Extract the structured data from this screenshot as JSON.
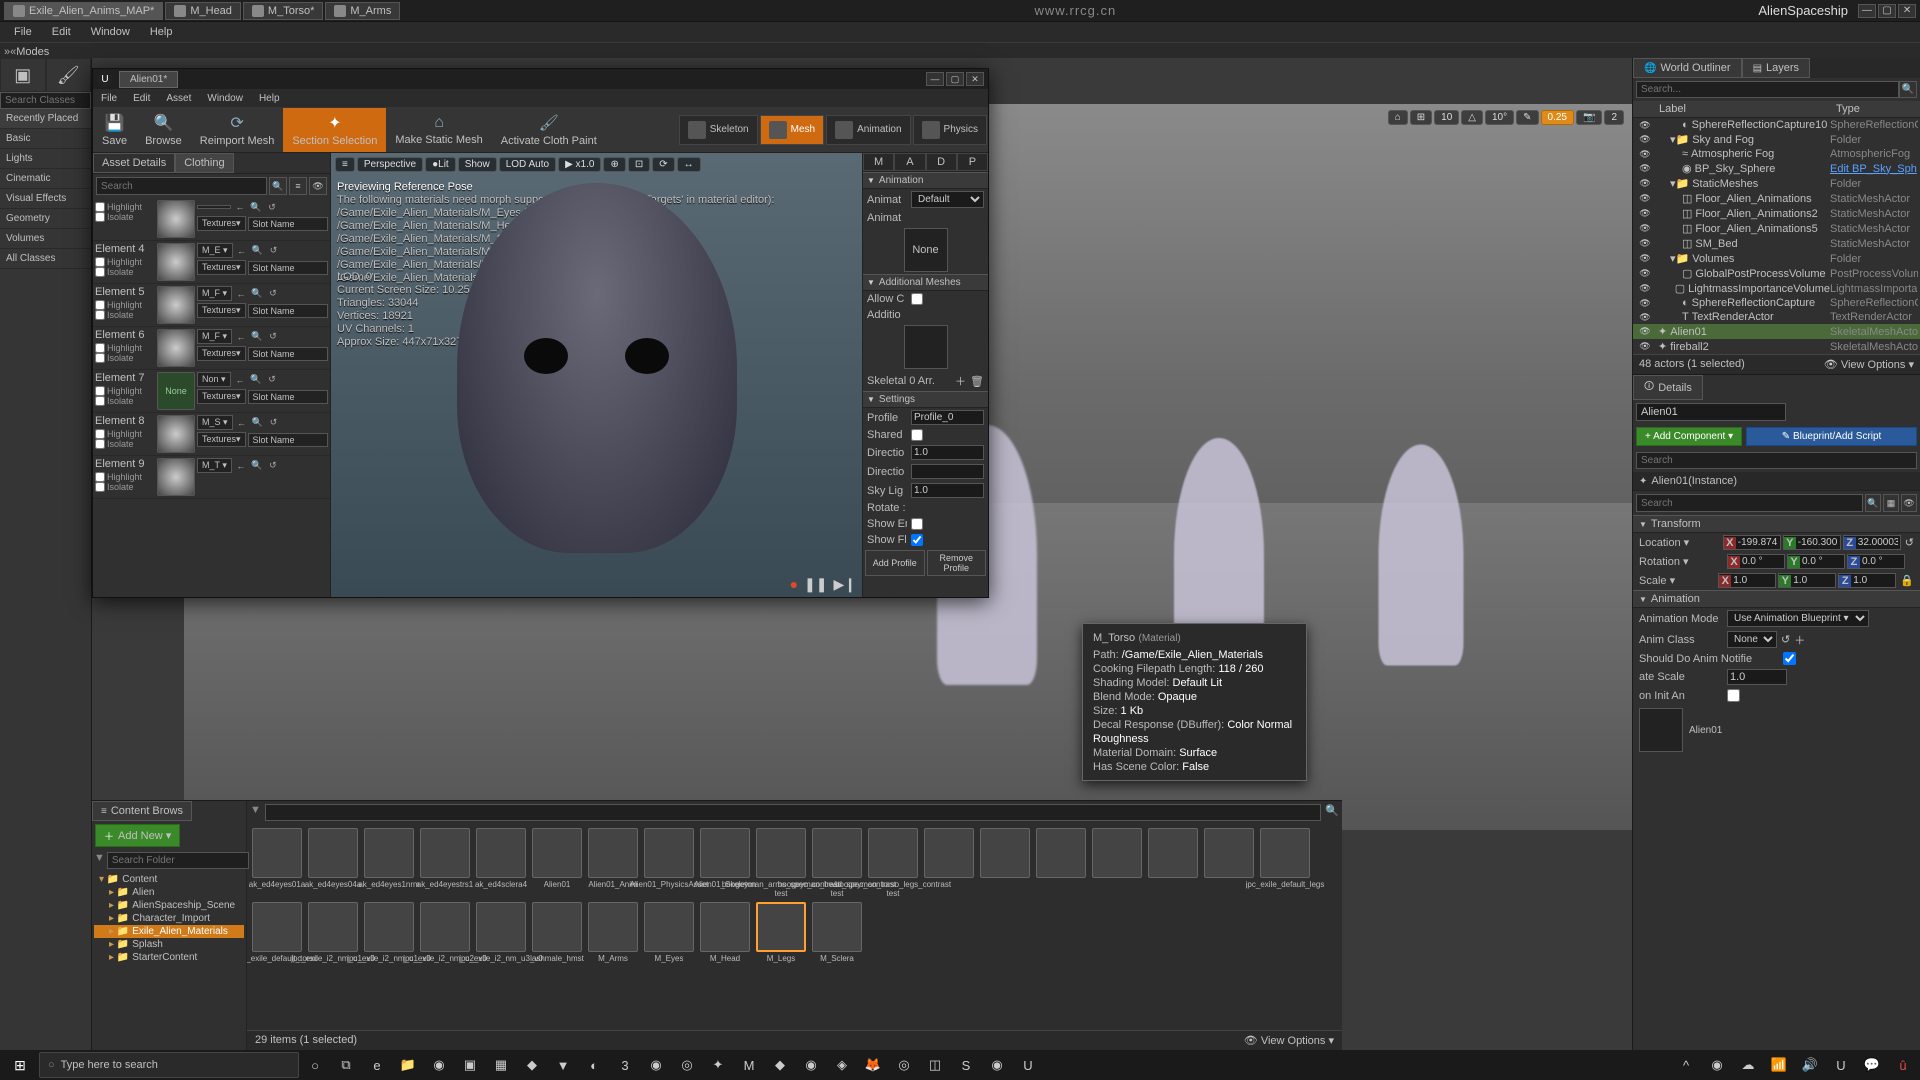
{
  "titlebar": {
    "tabs": [
      "Exile_Alien_Anims_MAP*",
      "M_Head",
      "M_Torso*",
      "M_Arms"
    ],
    "watermark": "www.rrcg.cn",
    "project": "AlienSpaceship"
  },
  "menubar": [
    "File",
    "Edit",
    "Window",
    "Help"
  ],
  "modes_label": "Modes",
  "left_panel": {
    "search_placeholder": "Search Classes",
    "categories": [
      "Recently Placed",
      "Basic",
      "Lights",
      "Cinematic",
      "Visual Effects",
      "Geometry",
      "Volumes",
      "All Classes"
    ]
  },
  "vpoverlay_pills": [
    "⌂",
    "⊞",
    "10",
    "△",
    "10°",
    "✎",
    "0.25",
    "📷",
    "2"
  ],
  "float": {
    "tab": "Alien01*",
    "menu": [
      "File",
      "Edit",
      "Asset",
      "Window",
      "Help"
    ],
    "toolbar": [
      {
        "label": "Save",
        "icon": "💾"
      },
      {
        "label": "Browse",
        "icon": "🔍"
      },
      {
        "label": "Reimport Mesh",
        "icon": "⟳"
      },
      {
        "label": "Section Selection",
        "icon": "✦",
        "active": true
      },
      {
        "label": "Make Static Mesh",
        "icon": "⌂"
      },
      {
        "label": "Activate Cloth Paint",
        "icon": "🖌"
      }
    ],
    "mode_tabs": [
      {
        "label": "Skeleton"
      },
      {
        "label": "Mesh",
        "active": true
      },
      {
        "label": "Animation"
      },
      {
        "label": "Physics"
      }
    ],
    "asset_details": {
      "tabs": [
        "Asset Details",
        "Clothing"
      ],
      "search_placeholder": "Search",
      "elements": [
        {
          "name": "",
          "highlight": "Highlight",
          "isolate": "Isolate",
          "mat": "",
          "textures": "Textures▾",
          "slot": "Slot Name"
        },
        {
          "name": "Element 4",
          "highlight": "Highlight",
          "isolate": "Isolate",
          "mat": "M_E ▾",
          "textures": "Textures▾",
          "slot": "Slot Name"
        },
        {
          "name": "Element 5",
          "highlight": "Highlight",
          "isolate": "Isolate",
          "mat": "M_F ▾",
          "textures": "Textures▾",
          "slot": "Slot Name"
        },
        {
          "name": "Element 6",
          "highlight": "Highlight",
          "isolate": "Isolate",
          "mat": "M_F ▾",
          "textures": "Textures▾",
          "slot": "Slot Name"
        },
        {
          "name": "Element 7",
          "highlight": "Highlight",
          "isolate": "Isolate",
          "mat": "Non ▾",
          "textures": "Textures▾",
          "slot": "Slot Name",
          "none": true
        },
        {
          "name": "Element 8",
          "highlight": "Highlight",
          "isolate": "Isolate",
          "mat": "M_S ▾",
          "textures": "Textures▾",
          "slot": "Slot Name"
        },
        {
          "name": "Element 9",
          "highlight": "Highlight",
          "isolate": "Isolate",
          "mat": "M_T ▾",
          "textures": "",
          "slot": ""
        }
      ]
    },
    "viewport": {
      "top_buttons": [
        "≡",
        "Perspective",
        "●Lit",
        "Show",
        "LOD Auto",
        "▶ x1.0"
      ],
      "preview_heading": "Previewing Reference Pose",
      "warning_head": "The following materials need morph support ('Used with Morph Targets' in material editor):",
      "warnings": [
        "/Game/Exile_Alien_Materials/M_Eyes.M_Eyes",
        "/Game/Exile_Alien_Materials/M_Head.M_Head",
        "/Game/Exile_Alien_Materials/M_Sclera.M_Sclera",
        "/Game/Exile_Alien_Materials/M_Torso.M_Torso",
        "/Game/Exile_Alien_Materials/M_Legs.M_Legs",
        "/Game/Exile_Alien_Materials/M_Arms.M_Arms"
      ],
      "stats": [
        "LOD: 0",
        "Current Screen Size: 10.25",
        "Triangles: 33044",
        "Vertices: 18921",
        "UV Channels: 1",
        "Approx Size: 447x71x327"
      ]
    },
    "preview_panel": {
      "top_tabs": [
        "M",
        "A",
        "D",
        "P"
      ],
      "sections": {
        "animation": "Animation",
        "additional": "Additional Meshes",
        "settings": "Settings"
      },
      "props": {
        "animat_label": "Animat",
        "animat_value": "Default",
        "animat2_label": "Animat",
        "animat2_value": "None",
        "allowc_label": "Allow C",
        "additio_label": "Additio",
        "skeletal_label": "Skeletal 0 Arr.",
        "profile_label": "Profile",
        "profile_value": "Profile_0",
        "shared_label": "Shared",
        "directio_label": "Directio",
        "directio_value": "1.0",
        "directio2_label": "Directio",
        "skylig_label": "Sky Lig",
        "skylig_value": "1.0",
        "rotate_label": "Rotate :",
        "showen_label": "Show En",
        "showfl_label": "Show Fl"
      },
      "add_profile": "Add Profile",
      "remove_profile": "Remove Profile"
    }
  },
  "outliner": {
    "tabs": [
      "World Outliner",
      "Layers"
    ],
    "search_placeholder": "Search...",
    "header": {
      "label": "Label",
      "type": "Type"
    },
    "rows": [
      {
        "indent": 2,
        "icon": "◐",
        "label": "SphereReflectionCapture10",
        "type": "SphereReflectionC"
      },
      {
        "indent": 1,
        "icon": "📁",
        "label": "Sky and Fog",
        "type": "Folder",
        "folder": true
      },
      {
        "indent": 2,
        "icon": "≈",
        "label": "Atmospheric Fog",
        "type": "AtmosphericFog"
      },
      {
        "indent": 2,
        "icon": "◉",
        "label": "BP_Sky_Sphere",
        "type": "Edit BP_Sky_Sph",
        "link": true
      },
      {
        "indent": 1,
        "icon": "📁",
        "label": "StaticMeshes",
        "type": "Folder",
        "folder": true
      },
      {
        "indent": 2,
        "icon": "◫",
        "label": "Floor_Alien_Animations",
        "type": "StaticMeshActor"
      },
      {
        "indent": 2,
        "icon": "◫",
        "label": "Floor_Alien_Animations2",
        "type": "StaticMeshActor"
      },
      {
        "indent": 2,
        "icon": "◫",
        "label": "Floor_Alien_Animations5",
        "type": "StaticMeshActor"
      },
      {
        "indent": 2,
        "icon": "◫",
        "label": "SM_Bed",
        "type": "StaticMeshActor"
      },
      {
        "indent": 1,
        "icon": "📁",
        "label": "Volumes",
        "type": "Folder",
        "folder": true
      },
      {
        "indent": 2,
        "icon": "▢",
        "label": "GlobalPostProcessVolume",
        "type": "PostProcessVolum"
      },
      {
        "indent": 2,
        "icon": "▢",
        "label": "LightmassImportanceVolume",
        "type": "LightmassImporta"
      },
      {
        "indent": 2,
        "icon": "◐",
        "label": "SphereReflectionCapture",
        "type": "SphereReflectionC"
      },
      {
        "indent": 2,
        "icon": "T",
        "label": "TextRenderActor",
        "type": "TextRenderActor"
      },
      {
        "indent": 0,
        "icon": "✦",
        "label": "Alien01",
        "type": "SkeletalMeshActor",
        "selected": true
      },
      {
        "indent": 0,
        "icon": "✦",
        "label": "fireball2",
        "type": "SkeletalMeshActor"
      }
    ],
    "footer": {
      "count": "48 actors (1 selected)",
      "view": "View Options ▾"
    }
  },
  "details": {
    "tab": "Details",
    "name": "Alien01",
    "add_component": "+ Add Component ▾",
    "blueprint": "✎ Blueprint/Add Script",
    "search_placeholder": "Search",
    "component": "Alien01(Instance)",
    "search2_placeholder": "Search",
    "transform": {
      "title": "Transform",
      "location_label": "Location ▾",
      "location": {
        "x": "-199.874",
        "y": "-160.300",
        "z": "32.00003"
      },
      "rotation_label": "Rotation ▾",
      "rotation": {
        "x": "0.0 °",
        "y": "0.0 °",
        "z": "0.0 °"
      },
      "scale_label": "Scale ▾",
      "scale": {
        "x": "1.0",
        "y": "1.0",
        "z": "1.0"
      }
    },
    "animation": {
      "title": "Animation",
      "mode_label": "Animation Mode",
      "mode_value": "Use Animation Blueprint ▾",
      "class_label": "Anim Class",
      "class_value": "None",
      "notifier_label": "Should Do Anim Notifie",
      "ratescale_label": "ate Scale",
      "ratescale_value": "1.0",
      "init_label": "on Init An"
    },
    "thumb_label": "Alien01"
  },
  "content_browser": {
    "tab": "Content Brows",
    "add_new": "Add New ▾",
    "search_folder": "Search Folder",
    "tree": [
      {
        "indent": 0,
        "label": "Content",
        "open": true
      },
      {
        "indent": 1,
        "label": "Alien"
      },
      {
        "indent": 1,
        "label": "AlienSpaceship_Scene"
      },
      {
        "indent": 1,
        "label": "Character_Import"
      },
      {
        "indent": 1,
        "label": "Exile_Alien_Materials",
        "selected": true
      },
      {
        "indent": 1,
        "label": "Splash"
      },
      {
        "indent": 1,
        "label": "StarterContent"
      }
    ],
    "tiles": [
      "ak_ed4eyes01a",
      "ak_ed4eyes04a",
      "ak_ed4eyes1nrm",
      "ak_ed4eyestrs1",
      "ak_ed4sclera4",
      "Alien01",
      "Alien01_Anim",
      "Alien01_PhysicsAsset",
      "Alien01_Skeleton",
      "boogeyman_arms_spec_contrast test",
      "boogeyman_head_spec_contrast test",
      "boogeyman_torso_legs_contrast test",
      "",
      "",
      "",
      "",
      "",
      "",
      "jpc_exile_default_legs",
      "jpc_exile_default_torso",
      "jpc_exile_i2_nm_u1_v0",
      "jpc_exile_i2_nm_u1_v0",
      "jpc_exile_i2_nm_u2_v0",
      "jpc_exile_i2_nm_u3_v0",
      "lashmale_hmst",
      "M_Arms",
      "M_Eyes",
      "M_Head",
      "M_Legs",
      "M_Sclera"
    ],
    "selected_tile": 29,
    "footer": {
      "count": "29 items (1 selected)",
      "view": "View Options ▾"
    }
  },
  "tooltip": {
    "title": "M_Torso",
    "subtitle": "(Material)",
    "rows": [
      {
        "k": "Path:",
        "v": "/Game/Exile_Alien_Materials"
      },
      {
        "k": "Cooking Filepath Length:",
        "v": "118 / 260"
      },
      {
        "k": "Shading Model:",
        "v": "Default Lit"
      },
      {
        "k": "Blend Mode:",
        "v": "Opaque"
      },
      {
        "k": "Size:",
        "v": "1 Kb"
      },
      {
        "k": "Decal Response (DBuffer):",
        "v": "Color Normal Roughness"
      },
      {
        "k": "Material Domain:",
        "v": "Surface"
      },
      {
        "k": "Has Scene Color:",
        "v": "False"
      }
    ]
  },
  "taskbar": {
    "search_placeholder": "Type here to search"
  }
}
